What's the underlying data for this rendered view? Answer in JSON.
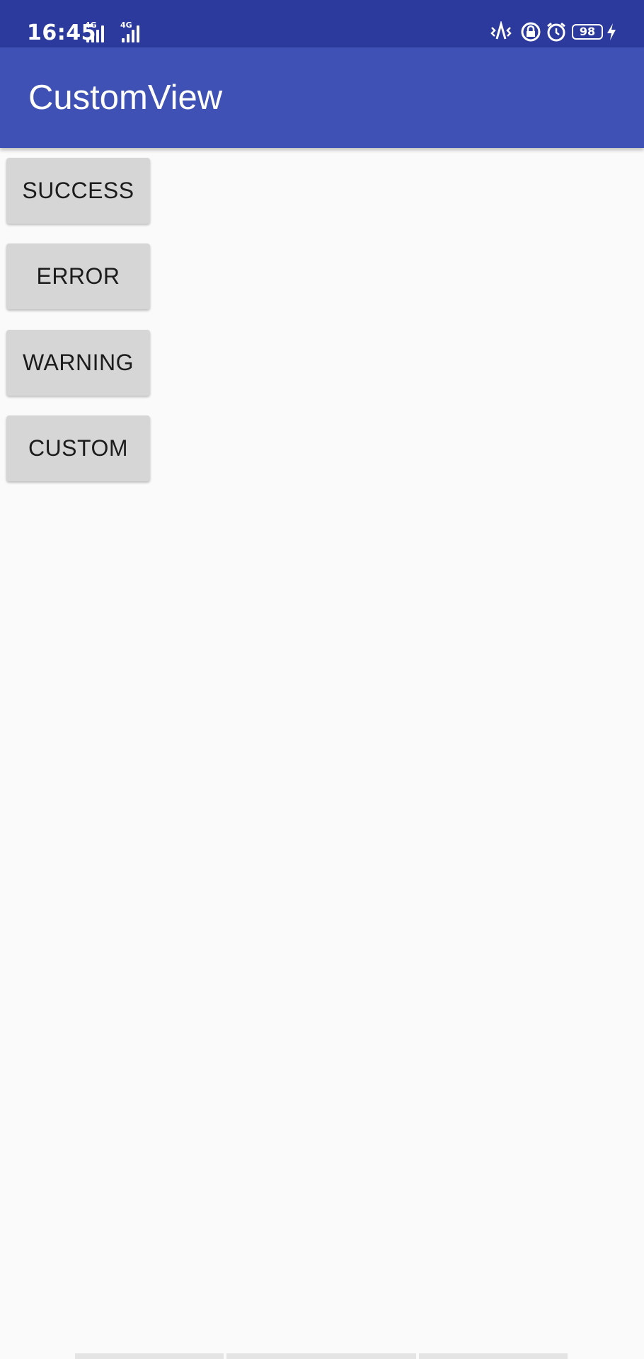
{
  "status_bar": {
    "time": "16:45",
    "sim1_network": "4G",
    "sim2_network": "4G",
    "battery_level": "98",
    "icons": [
      "signal-4g-sim1-icon",
      "signal-4g-sim2-icon",
      "vibrate-icon",
      "vpn-lock-icon",
      "alarm-icon",
      "battery-icon",
      "charging-icon"
    ]
  },
  "app_bar": {
    "title": "CustomView",
    "color": "#3f51b5"
  },
  "buttons": [
    {
      "label": "SUCCESS"
    },
    {
      "label": "ERROR"
    },
    {
      "label": "WARNING"
    },
    {
      "label": "CUSTOM"
    }
  ]
}
